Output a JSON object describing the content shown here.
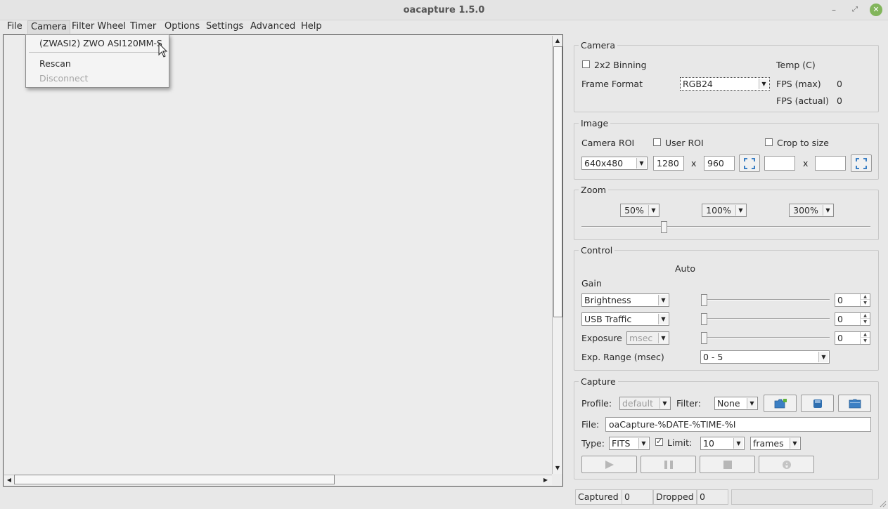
{
  "window": {
    "title": "oacapture 1.5.0"
  },
  "menubar": {
    "items": [
      {
        "label": "File",
        "underline": "F"
      },
      {
        "label": "Camera",
        "underline": "C"
      },
      {
        "label": "Filter Wheel",
        "underline": "W"
      },
      {
        "label": "Timer",
        "underline": "T"
      },
      {
        "label": "Options",
        "underline": "O"
      },
      {
        "label": "Settings",
        "underline": "S"
      },
      {
        "label": "Advanced",
        "underline": "A"
      },
      {
        "label": "Help",
        "underline": "H"
      }
    ]
  },
  "camera_menu": {
    "items": [
      {
        "label": "(ZWASI2) ZWO ASI120MM-S",
        "enabled": true
      },
      {
        "label": "Rescan",
        "enabled": true
      },
      {
        "label": "Disconnect",
        "enabled": false
      }
    ]
  },
  "camera_group": {
    "title": "Camera",
    "binning_label": "2x2 Binning",
    "binning_checked": false,
    "frame_format_label": "Frame Format",
    "frame_format_value": "RGB24",
    "temp_label": "Temp (C)",
    "fps_max_label": "FPS (max)",
    "fps_max_value": "0",
    "fps_actual_label": "FPS (actual)",
    "fps_actual_value": "0"
  },
  "image_group": {
    "title": "Image",
    "camera_roi_label": "Camera ROI",
    "user_roi_label": "User ROI",
    "user_roi_checked": false,
    "crop_label": "Crop to size",
    "crop_checked": false,
    "roi_value": "640x480",
    "width_value": "1280",
    "x_label": "x",
    "height_value": "960",
    "crop_width_value": "",
    "crop_height_value": ""
  },
  "zoom_group": {
    "title": "Zoom",
    "buttons": [
      "50%",
      "100%",
      "300%"
    ],
    "slider_fraction": 0.28
  },
  "control_group": {
    "title": "Control",
    "auto_label": "Auto",
    "gain_label": "Gain",
    "rows": [
      {
        "control": "Brightness",
        "value": "0",
        "slider_fraction": 0.0
      },
      {
        "control": "USB Traffic",
        "value": "0",
        "slider_fraction": 0.0
      }
    ],
    "exposure_label": "Exposure",
    "exposure_unit": "msec",
    "exposure_value": "0",
    "exposure_slider_fraction": 0.0,
    "exp_range_label": "Exp. Range (msec)",
    "exp_range_value": "0 - 5"
  },
  "capture_group": {
    "title": "Capture",
    "profile_label": "Profile:",
    "profile_value": "default",
    "filter_label": "Filter:",
    "filter_value": "None",
    "file_label": "File:",
    "file_value": "oaCapture-%DATE-%TIME-%I",
    "type_label": "Type:",
    "type_value": "FITS",
    "limit_label": "Limit:",
    "limit_checked": true,
    "limit_value": "10",
    "limit_unit": "frames"
  },
  "statusbar": {
    "captured_label": "Captured",
    "captured_value": "0",
    "dropped_label": "Dropped",
    "dropped_value": "0"
  },
  "colors": {
    "accent": "#3b7fc4",
    "close": "#82b55b"
  }
}
